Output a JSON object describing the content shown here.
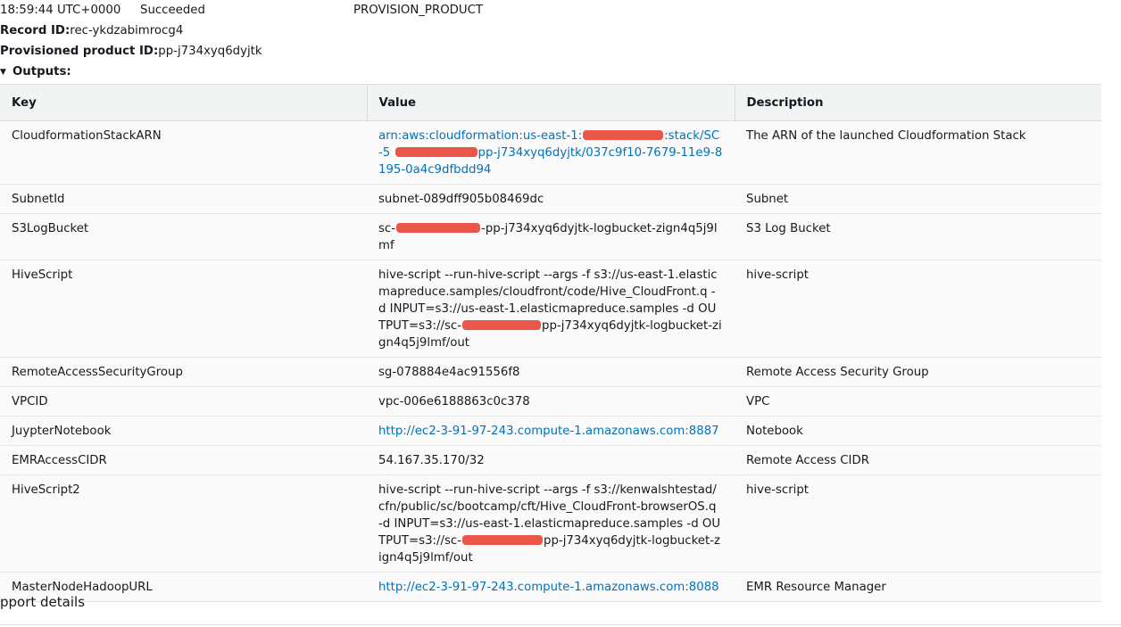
{
  "status": {
    "time": "18:59:44 UTC+0000",
    "state": "Succeeded",
    "type": "PROVISION_PRODUCT"
  },
  "record": {
    "label": "Record ID:",
    "value": "rec-ykdzabimrocg4"
  },
  "provisioned_product": {
    "label": "Provisioned product ID:",
    "value": "pp-j734xyq6dyjtk"
  },
  "outputs": {
    "toggle_label": "Outputs:",
    "headers": {
      "key": "Key",
      "value": "Value",
      "description": "Description"
    },
    "rows": [
      {
        "key": "CloudformationStackARN",
        "value_a": "arn:aws:cloudformation:us-east-1:",
        "value_b": ":stack/SC-5",
        "value_c": "pp-j734xyq6dyjtk/037c9f10-7679-11e9-8195-0a4c9dfbdd94",
        "description": "The ARN of the launched Cloudformation Stack"
      },
      {
        "key": "SubnetId",
        "value": "subnet-089dff905b08469dc",
        "description": "Subnet"
      },
      {
        "key": "S3LogBucket",
        "value_a": "sc-",
        "value_b": "-pp-j734xyq6dyjtk-logbucket-zign4q5j9lmf",
        "description": "S3 Log Bucket"
      },
      {
        "key": "HiveScript",
        "value_a": "hive-script --run-hive-script --args -f s3://us-east-1.elasticmapreduce.samples/cloudfront/code/Hive_CloudFront.q -d INPUT=s3://us-east-1.elasticmapreduce.samples -d OUTPUT=s3://sc-",
        "value_b": "pp-j734xyq6dyjtk-logbucket-zign4q5j9lmf/out",
        "description": "hive-script"
      },
      {
        "key": "RemoteAccessSecurityGroup",
        "value": "sg-078884e4ac91556f8",
        "description": "Remote Access Security Group"
      },
      {
        "key": "VPCID",
        "value": "vpc-006e6188863c0c378",
        "description": "VPC"
      },
      {
        "key": "JuypterNotebook",
        "value": "http://ec2-3-91-97-243.compute-1.amazonaws.com:8887",
        "description": "Notebook"
      },
      {
        "key": "EMRAccessCIDR",
        "value": "54.167.35.170/32",
        "description": "Remote Access CIDR"
      },
      {
        "key": "HiveScript2",
        "value_a": "hive-script --run-hive-script --args -f s3://kenwalshtestad/cfn/public/sc/bootcamp/cft/Hive_CloudFront-browserOS.q -d INPUT=s3://us-east-1.elasticmapreduce.samples -d OUTPUT=s3://sc-",
        "value_b": "pp-j734xyq6dyjtk-logbucket-zign4q5j9lmf/out",
        "description": "hive-script"
      },
      {
        "key": "MasterNodeHadoopURL",
        "value": "http://ec2-3-91-97-243.compute-1.amazonaws.com:8088",
        "description": "EMR Resource Manager"
      }
    ]
  },
  "support": {
    "label": "pport details"
  },
  "colors": {
    "link": "#0073bb",
    "redaction": "#e8574a",
    "header_bg": "#f2f3f3",
    "row_bg": "#fafafa"
  },
  "icons": {
    "outputs_toggle": "caret-down-icon"
  }
}
